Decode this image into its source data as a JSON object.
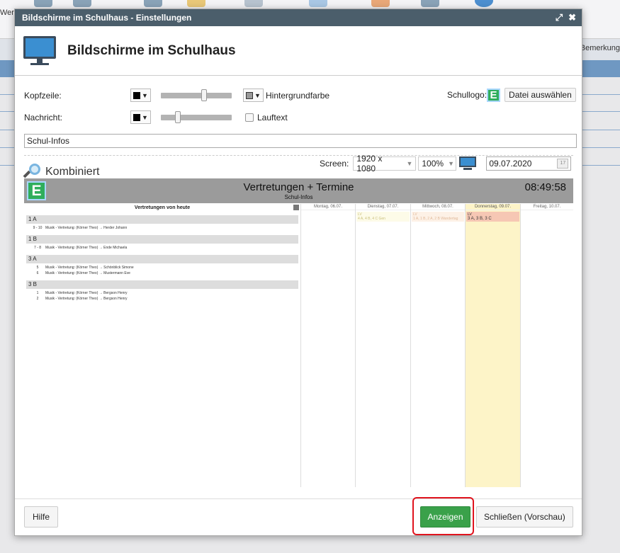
{
  "background": {
    "left_label": "Wer",
    "right_label": "Bemerkung"
  },
  "dialog": {
    "title": "Bildschirme im Schulhaus - Einstellungen",
    "heading": "Bildschirme im Schulhaus",
    "expand_icon": "expand-icon",
    "close_icon": "close-icon"
  },
  "settings": {
    "kopfzeile_label": "Kopfzeile:",
    "nachricht_label": "Nachricht:",
    "hintergrund_label": "Hintergrundfarbe",
    "lauftext_label": "Lauftext",
    "schullogo_label": "Schullogo:",
    "datei_button": "Datei auswählen",
    "logo_letter": "E",
    "message_value": "Schul-Infos",
    "kopfzeile_text_color": "#000000",
    "kopfzeile_bg_color": "#999999",
    "nachricht_color": "#000000",
    "kopfzeile_slider_level": 0.62,
    "nachricht_slider_level": 0.22,
    "lauftext_checked": false
  },
  "viewbar": {
    "mode_label": "Kombiniert",
    "screen_label": "Screen:",
    "resolution": "1920 x 1080",
    "zoom": "100%",
    "date": "09.07.2020",
    "calendar_day": "17"
  },
  "preview": {
    "logo_letter": "E",
    "title": "Vertretungen + Termine",
    "subtitle": "Schul-Infos",
    "clock": "08:49:58",
    "left_title": "Vertretungen von heute",
    "classes": [
      {
        "name": "1 A",
        "entries": [
          {
            "hour": "9 - 10",
            "text": "Musik - Vertretung: (Körner Theo) → Herder Johann"
          }
        ]
      },
      {
        "name": "1 B",
        "entries": [
          {
            "hour": "7 - 8",
            "text": "Musik - Vertretung: (Körner Theo) → Ende Michaela"
          }
        ]
      },
      {
        "name": "3 A",
        "entries": [
          {
            "hour": "5",
            "text": "Musik - Vertretung: (Körner Theo) → Schönblick Simone"
          },
          {
            "hour": "6",
            "text": "Musik - Vertretung: (Körner Theo) → Mustermann Eve"
          }
        ]
      },
      {
        "name": "3 B",
        "entries": [
          {
            "hour": "1",
            "text": "Musik - Vertretung: (Körner Theo) → Bergson Henry"
          },
          {
            "hour": "2",
            "text": "Musik - Vertretung: (Körner Theo) → Bergson Henry"
          }
        ]
      }
    ],
    "days": [
      {
        "label": "Montag, 06.07.",
        "events": []
      },
      {
        "label": "Dienstag, 07.07.",
        "events": [
          {
            "line1": "LV",
            "line2": "4 A, 4 B, 4 C Gen"
          }
        ]
      },
      {
        "label": "Mittwoch, 08.07.",
        "events": [
          {
            "line1": "LV",
            "line2": "1 A, 1 B, 2 A, 2 B Wandertag"
          }
        ]
      },
      {
        "label": "Donnerstag, 09.07.",
        "events": [
          {
            "line1": "LV",
            "line2": "3 A, 3 B, 3 C"
          }
        ]
      },
      {
        "label": "Freitag, 10.07.",
        "events": []
      }
    ]
  },
  "footer": {
    "hilfe_button": "Hilfe",
    "anzeigen_button": "Anzeigen",
    "schliessen_button": "Schließen (Vorschau)"
  },
  "colors": {
    "titlebar": "#4b5e6b",
    "accent_green": "#3aa14a",
    "highlight_red": "#e0141e",
    "today_column": "#fdf4c8"
  }
}
